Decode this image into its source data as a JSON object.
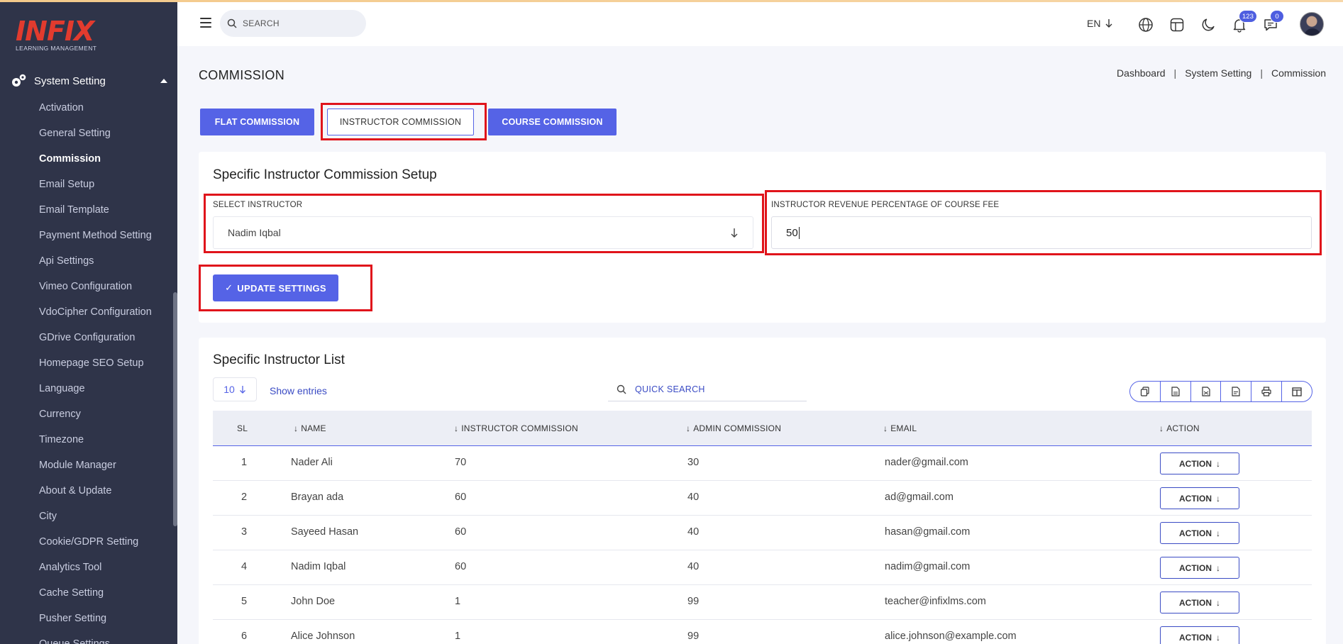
{
  "brand": {
    "name": "INFIX",
    "tagline": "LEARNING MANAGEMENT",
    "accent": "#e23b2e"
  },
  "sidebar": {
    "section": "System Setting",
    "items": [
      {
        "label": "Activation"
      },
      {
        "label": "General Setting"
      },
      {
        "label": "Commission",
        "active": true
      },
      {
        "label": "Email Setup"
      },
      {
        "label": "Email Template"
      },
      {
        "label": "Payment Method Setting"
      },
      {
        "label": "Api Settings"
      },
      {
        "label": "Vimeo Configuration"
      },
      {
        "label": "VdoCipher Configuration"
      },
      {
        "label": "GDrive Configuration"
      },
      {
        "label": "Homepage SEO Setup"
      },
      {
        "label": "Language"
      },
      {
        "label": "Currency"
      },
      {
        "label": "Timezone"
      },
      {
        "label": "Module Manager"
      },
      {
        "label": "About & Update"
      },
      {
        "label": "City"
      },
      {
        "label": "Cookie/GDPR Setting"
      },
      {
        "label": "Analytics Tool"
      },
      {
        "label": "Cache Setting"
      },
      {
        "label": "Pusher Setting"
      },
      {
        "label": "Queue Settings"
      }
    ]
  },
  "header": {
    "search_placeholder": "SEARCH",
    "language": "EN",
    "notifications_count": "123",
    "messages_count": "0",
    "icons": [
      "globe-icon",
      "layout-icon",
      "moon-icon",
      "bell-icon",
      "chat-icon"
    ]
  },
  "page": {
    "title": "COMMISSION",
    "breadcrumb": [
      "Dashboard",
      "System Setting",
      "Commission"
    ]
  },
  "tabs": [
    {
      "label": "FLAT COMMISSION",
      "selected": false
    },
    {
      "label": "INSTRUCTOR COMMISSION",
      "selected": true
    },
    {
      "label": "COURSE COMMISSION",
      "selected": false
    }
  ],
  "setup": {
    "title": "Specific Instructor Commission Setup",
    "select_label": "SELECT INSTRUCTOR",
    "select_value": "Nadim Iqbal",
    "revenue_label": "INSTRUCTOR REVENUE PERCENTAGE OF COURSE FEE",
    "revenue_value": "50",
    "update_button": "UPDATE SETTINGS"
  },
  "list": {
    "title": "Specific Instructor List",
    "page_size": "10",
    "show_entries": "Show entries",
    "search_placeholder": "QUICK SEARCH",
    "export_icons": [
      "copy-icon",
      "csv-icon",
      "excel-icon",
      "pdf-icon",
      "print-icon",
      "columns-icon"
    ],
    "columns": [
      "SL",
      "NAME",
      "INSTRUCTOR COMMISSION",
      "ADMIN COMMISSION",
      "EMAIL",
      "ACTION"
    ],
    "rows": [
      {
        "sl": "1",
        "name": "Nader Ali",
        "instructor": "70",
        "admin": "30",
        "email": "nader@gmail.com",
        "action": "ACTION"
      },
      {
        "sl": "2",
        "name": "Brayan ada",
        "instructor": "60",
        "admin": "40",
        "email": "ad@gmail.com",
        "action": "ACTION"
      },
      {
        "sl": "3",
        "name": "Sayeed Hasan",
        "instructor": "60",
        "admin": "40",
        "email": "hasan@gmail.com",
        "action": "ACTION"
      },
      {
        "sl": "4",
        "name": "Nadim Iqbal",
        "instructor": "60",
        "admin": "40",
        "email": "nadim@gmail.com",
        "action": "ACTION"
      },
      {
        "sl": "5",
        "name": "John Doe",
        "instructor": "1",
        "admin": "99",
        "email": "teacher@infixlms.com",
        "action": "ACTION"
      },
      {
        "sl": "6",
        "name": "Alice Johnson",
        "instructor": "1",
        "admin": "99",
        "email": "alice.johnson@example.com",
        "action": "ACTION"
      }
    ]
  },
  "colors": {
    "primary": "#5563e6",
    "sidebar": "#2f3449",
    "highlight": "#e0141b"
  }
}
